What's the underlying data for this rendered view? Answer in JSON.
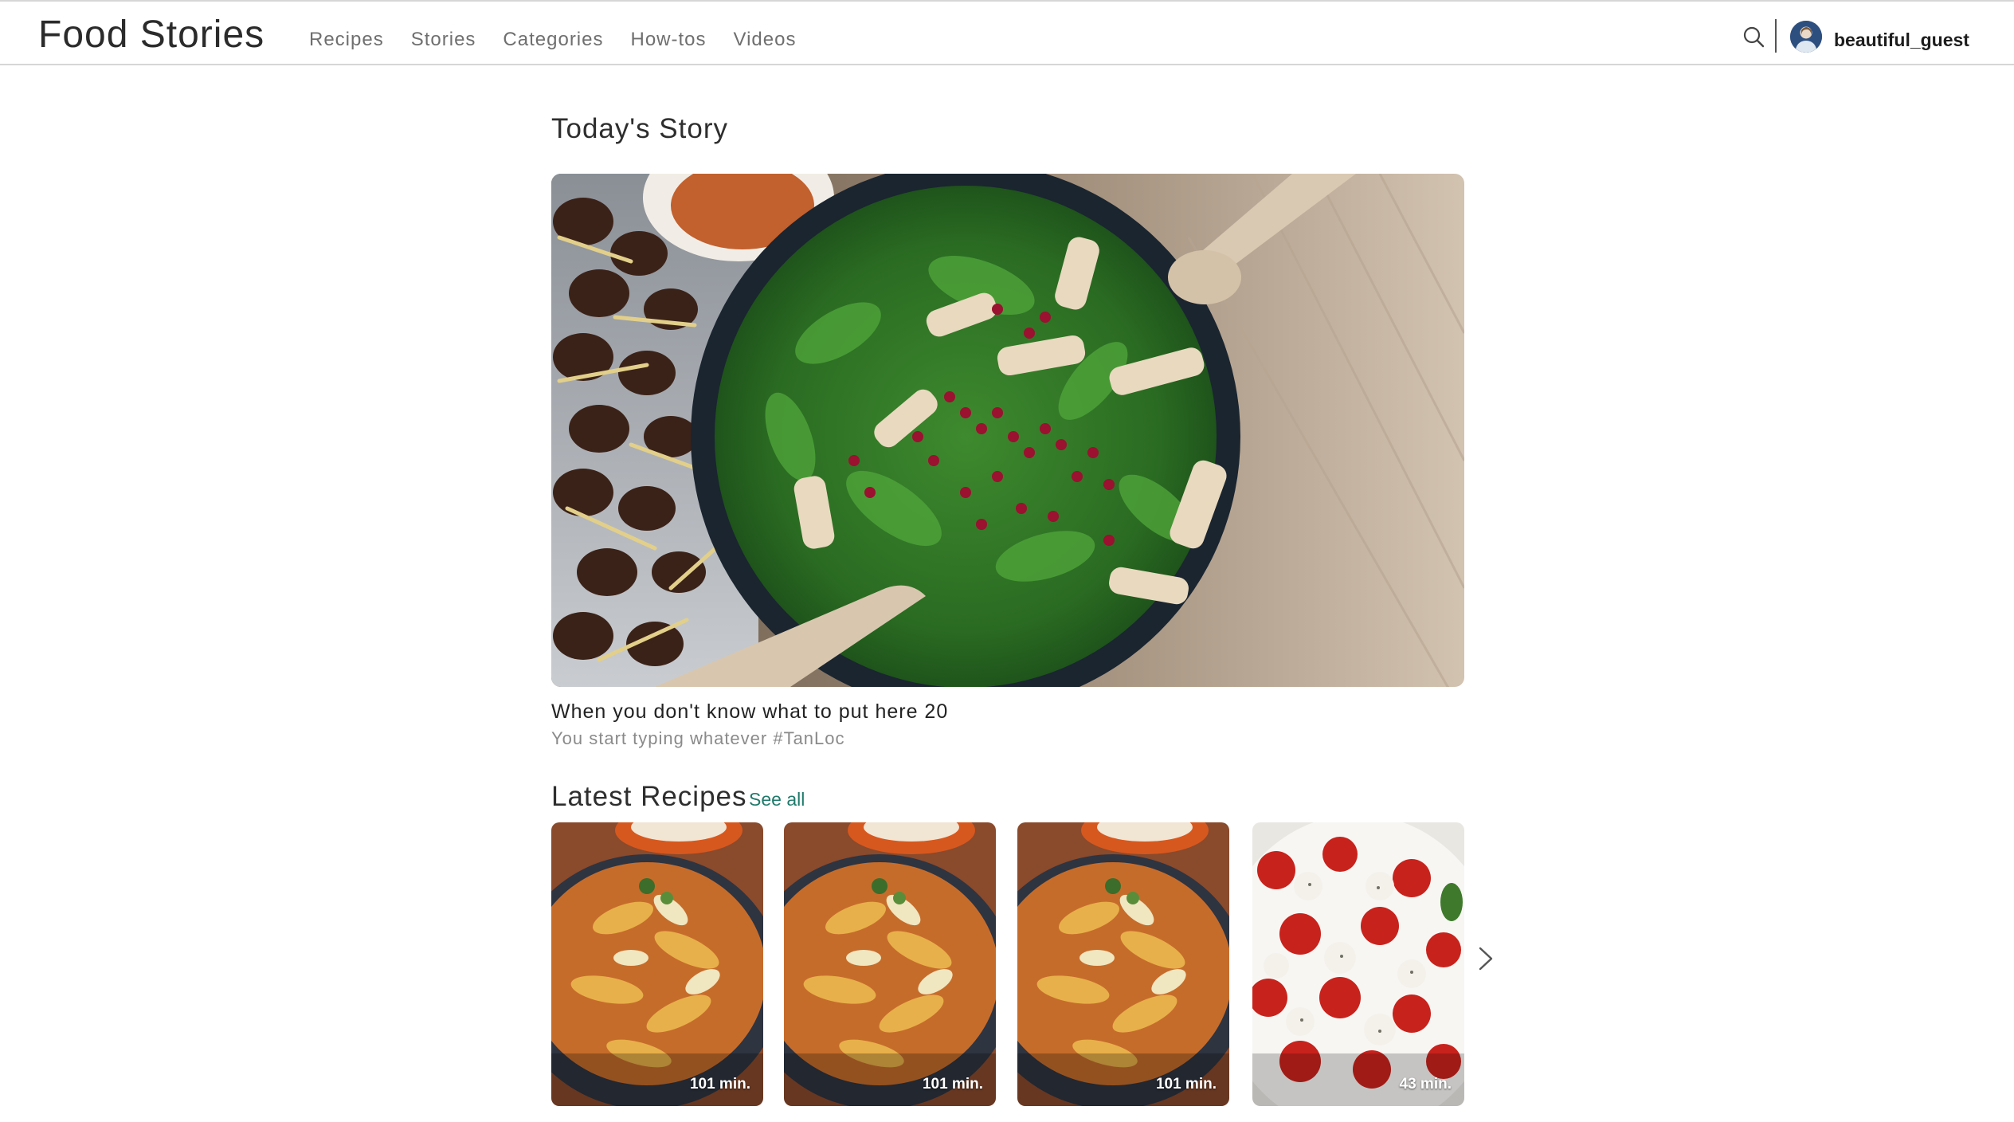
{
  "header": {
    "brand": "Food Stories",
    "nav": [
      "Recipes",
      "Stories",
      "Categories",
      "How-tos",
      "Videos"
    ],
    "username": "beautiful_guest"
  },
  "todays_story": {
    "heading": "Today's Story",
    "title": "When you don't know what to put here 20",
    "subtitle": "You start typing whatever #TanLoc"
  },
  "latest_recipes": {
    "heading": "Latest Recipes",
    "see_all": "See all",
    "cards": [
      {
        "time": "101 min."
      },
      {
        "time": "101 min."
      },
      {
        "time": "101 min."
      },
      {
        "time": "43 min."
      }
    ]
  },
  "colors": {
    "accent": "#1f7a6b",
    "text": "#2e2e2e",
    "muted": "#8a8a8a"
  }
}
